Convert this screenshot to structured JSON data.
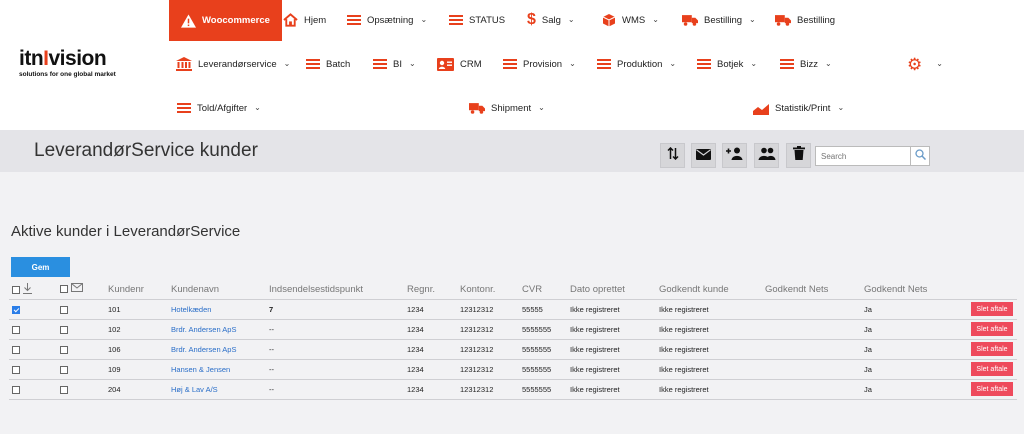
{
  "logo": {
    "brand_left": "itn",
    "brand_bar": "I",
    "brand_right": "vision",
    "tagline": "solutions for one global market"
  },
  "nav": {
    "woocommerce": "Woocommerce",
    "hjem": "Hjem",
    "opsaetning": "Opsætning",
    "status": "STATUS",
    "salg": "Salg",
    "wms": "WMS",
    "bestilling1": "Bestilling",
    "bestilling2": "Bestilling",
    "leverandorservice": "Leverandørservice",
    "batch": "Batch",
    "bi": "BI",
    "crm": "CRM",
    "provision": "Provision",
    "produktion": "Produktion",
    "botjek": "Botjek",
    "bizz": "Bizz",
    "told": "Told/Afgifter",
    "shipment": "Shipment",
    "statistik": "Statistik/Print"
  },
  "header": {
    "title": "LeverandørService kunder",
    "search_placeholder": "Search"
  },
  "section_title": "Aktive kunder i LeverandørService",
  "save_label": "Gem",
  "table": {
    "columns": [
      "Kundenr",
      "Kundenavn",
      "Indsendelsestidspunkt",
      "Regnr.",
      "Kontonr.",
      "CVR",
      "Dato oprettet",
      "Godkendt kunde",
      "Godkendt Nets",
      "Godkendt Nets"
    ],
    "rows": [
      {
        "checked": true,
        "kundenr": "101",
        "navn": "Hotelkæden",
        "tid": "7",
        "regnr": "1234",
        "konto": "12312312",
        "cvr": "55555",
        "dato": "Ikke registreret",
        "godk_kunde": "Ikke registreret",
        "godk_nets1": "",
        "godk_nets2": "Ja",
        "action": "Slet aftale"
      },
      {
        "checked": false,
        "kundenr": "102",
        "navn": "Brdr. Andersen ApS",
        "tid": "--",
        "regnr": "1234",
        "konto": "12312312",
        "cvr": "5555555",
        "dato": "Ikke registreret",
        "godk_kunde": "Ikke registreret",
        "godk_nets1": "",
        "godk_nets2": "Ja",
        "action": "Slet aftale"
      },
      {
        "checked": false,
        "kundenr": "106",
        "navn": "Brdr. Andersen ApS",
        "tid": "--",
        "regnr": "1234",
        "konto": "12312312",
        "cvr": "5555555",
        "dato": "Ikke registreret",
        "godk_kunde": "Ikke registreret",
        "godk_nets1": "",
        "godk_nets2": "Ja",
        "action": "Slet aftale"
      },
      {
        "checked": false,
        "kundenr": "109",
        "navn": "Hansen & Jensen",
        "tid": "--",
        "regnr": "1234",
        "konto": "12312312",
        "cvr": "5555555",
        "dato": "Ikke registreret",
        "godk_kunde": "Ikke registreret",
        "godk_nets1": "",
        "godk_nets2": "Ja",
        "action": "Slet aftale"
      },
      {
        "checked": false,
        "kundenr": "204",
        "navn": "Høj & Lav A/S",
        "tid": "--",
        "regnr": "1234",
        "konto": "12312312",
        "cvr": "5555555",
        "dato": "Ikke registreret",
        "godk_kunde": "Ikke registreret",
        "godk_nets1": "",
        "godk_nets2": "Ja",
        "action": "Slet aftale"
      }
    ]
  },
  "colors": {
    "accent": "#e8401c",
    "primary_button": "#2a8fe0",
    "danger_button": "#ee4a5c",
    "link": "#2a6ec8"
  }
}
